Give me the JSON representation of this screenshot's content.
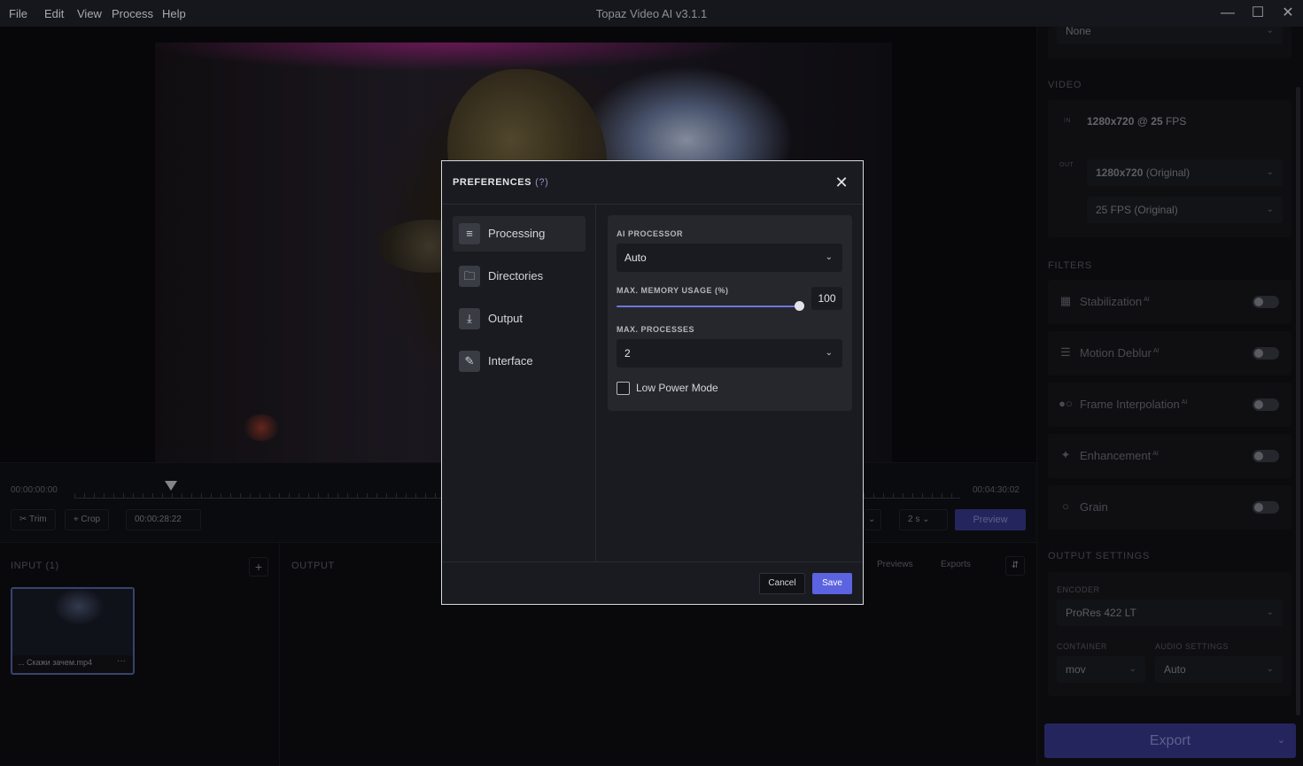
{
  "window": {
    "title": "Topaz Video AI  v3.1.1"
  },
  "menu": [
    "File",
    "Edit",
    "View",
    "Process",
    "Help"
  ],
  "timeline": {
    "start_time": "00:00:00:00",
    "end_time": "00:04:30:02",
    "current_time": "00:00:28:22",
    "trim_label": "Trim",
    "crop_label": "Crop",
    "preview_duration": "2 s",
    "preview_label": "Preview"
  },
  "input_panel": {
    "title": "INPUT (1)",
    "add_label": "+",
    "file_name": "... Скажи зачем.mp4",
    "more_label": "···"
  },
  "output_panel": {
    "title": "OUTPUT",
    "tabs": [
      "Previews",
      "Exports"
    ]
  },
  "right_panel": {
    "top_select": "None",
    "video_section": "VIDEO",
    "in_label": "IN",
    "in_resolution": "1280x720",
    "in_at": "@",
    "in_fps": "25",
    "in_fps_unit": "FPS",
    "out_label": "OUT",
    "out_resolution": "1280x720",
    "out_resolution_note": "(Original)",
    "out_fps": "25 FPS (Original)",
    "filters_section": "FILTERS",
    "filters": [
      {
        "name": "Stabilization",
        "ai": "AI",
        "icon": "stabilization-icon",
        "enabled": false
      },
      {
        "name": "Motion Deblur",
        "ai": "AI",
        "icon": "motion-deblur-icon",
        "enabled": false
      },
      {
        "name": "Frame Interpolation",
        "ai": "AI",
        "icon": "frame-interpolation-icon",
        "enabled": false
      },
      {
        "name": "Enhancement",
        "ai": "AI",
        "icon": "enhancement-icon",
        "enabled": false
      },
      {
        "name": "Grain",
        "ai": "",
        "icon": "grain-icon",
        "enabled": false
      }
    ],
    "output_settings_section": "OUTPUT SETTINGS",
    "encoder_label": "ENCODER",
    "encoder_value": "ProRes 422 LT",
    "container_label": "CONTAINER",
    "container_value": "mov",
    "audio_label": "AUDIO SETTINGS",
    "audio_value": "Auto",
    "export_label": "Export"
  },
  "modal": {
    "title": "PREFERENCES",
    "help": "(?)",
    "nav": [
      {
        "label": "Processing",
        "icon": "sliders-icon",
        "active": true
      },
      {
        "label": "Directories",
        "icon": "folder-icon",
        "active": false
      },
      {
        "label": "Output",
        "icon": "download-icon",
        "active": false
      },
      {
        "label": "Interface",
        "icon": "edit-icon",
        "active": false
      }
    ],
    "ai_processor_label": "AI PROCESSOR",
    "ai_processor_value": "Auto",
    "memory_label": "MAX. MEMORY USAGE (%)",
    "memory_value": "100",
    "memory_fraction": 1.0,
    "processes_label": "MAX. PROCESSES",
    "processes_value": "2",
    "low_power_label": "Low Power Mode",
    "low_power_checked": false,
    "cancel_label": "Cancel",
    "save_label": "Save"
  },
  "colors": {
    "accent": "#5b63e0",
    "export_button": "#3a3a8f",
    "slider": "#6e76d8"
  }
}
